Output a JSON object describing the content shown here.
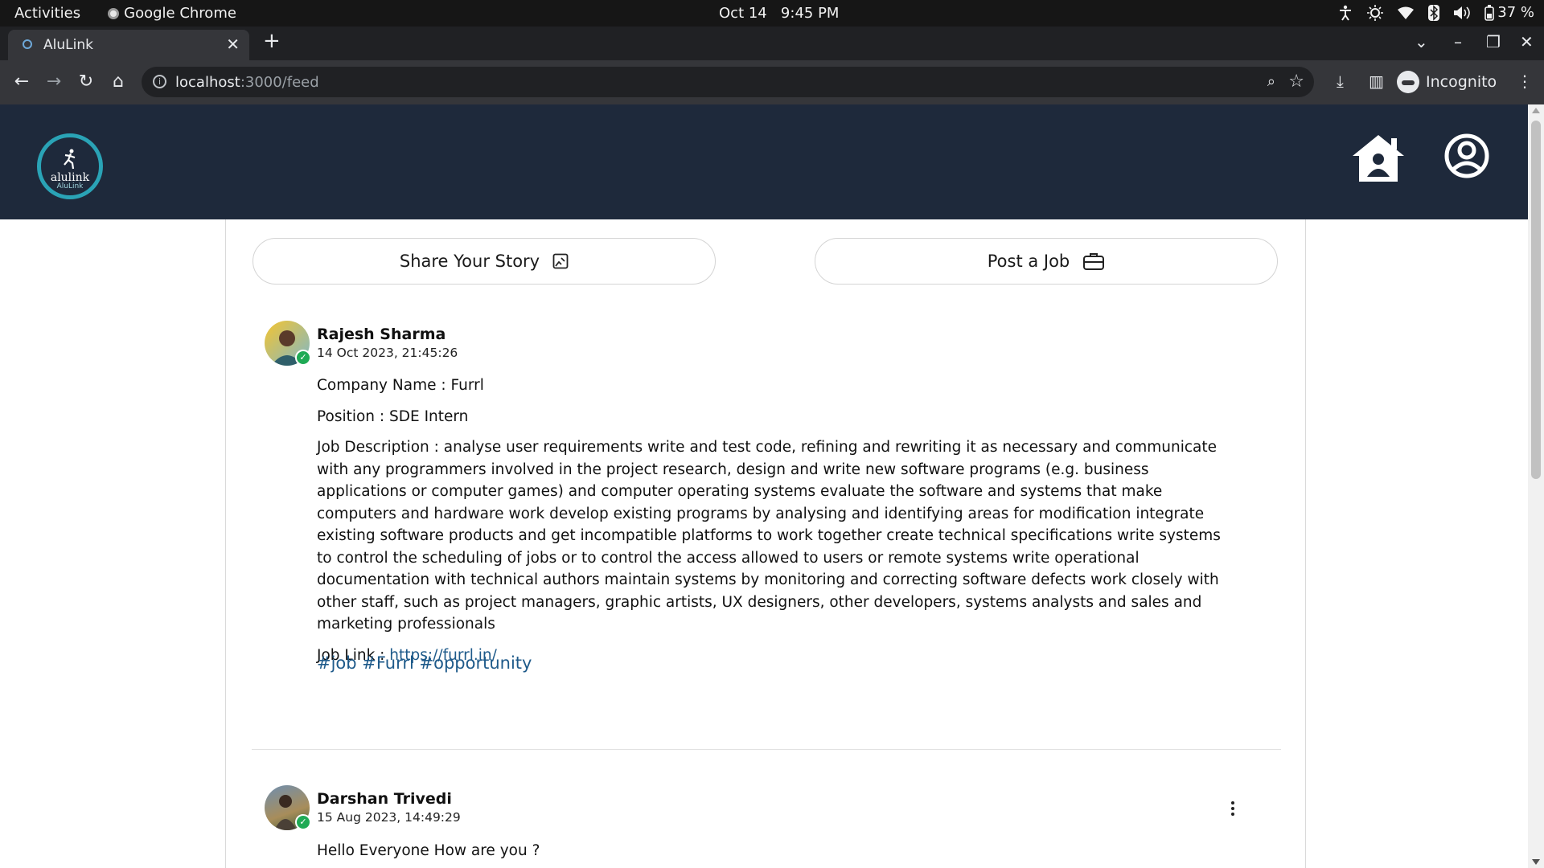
{
  "os_bar": {
    "activities": "Activities",
    "app_name": "Google Chrome",
    "date": "Oct 14",
    "time": "9:45 PM",
    "battery": "37 %"
  },
  "browser": {
    "tab_title": "AluLink",
    "url_host": "localhost",
    "url_path": ":3000/feed",
    "profile_label": "Incognito"
  },
  "app": {
    "logo_text_top": "alulink",
    "logo_text_bottom": "AluLink"
  },
  "actions": {
    "share_story": "Share Your Story",
    "post_job": "Post a Job"
  },
  "posts": [
    {
      "author": "Rajesh Sharma",
      "timestamp": "14 Oct 2023, 21:45:26",
      "company": "Company Name : Furrl",
      "position": "Position : SDE Intern",
      "description": "Job Description : analyse user requirements write and test code, refining and rewriting it as necessary and communicate with any programmers involved in the project research, design and write new software programs (e.g. business applications or computer games) and computer operating systems evaluate the software and systems that make computers and hardware work develop existing programs by analysing and identifying areas for modification integrate existing software products and get incompatible platforms to work together create technical specifications write systems to control the scheduling of jobs or to control the access allowed to users or remote systems write operational documentation with technical authors maintain systems by monitoring and correcting software defects work closely with other staff, such as project managers, graphic artists, UX designers, other developers, systems analysts and sales and marketing professionals",
      "job_link_label": "Job Link : ",
      "job_link": "https://furrl.in/",
      "tags": "#job #Furrl #opportunity"
    },
    {
      "author": "Darshan Trivedi",
      "timestamp": "15 Aug 2023, 14:49:29",
      "text": "Hello Everyone How are you ?"
    }
  ],
  "colors": {
    "header_bg": "#1e293b",
    "link": "#1e5a8a",
    "verified": "#1faa55",
    "logo_ring": "#2aa3b6"
  }
}
